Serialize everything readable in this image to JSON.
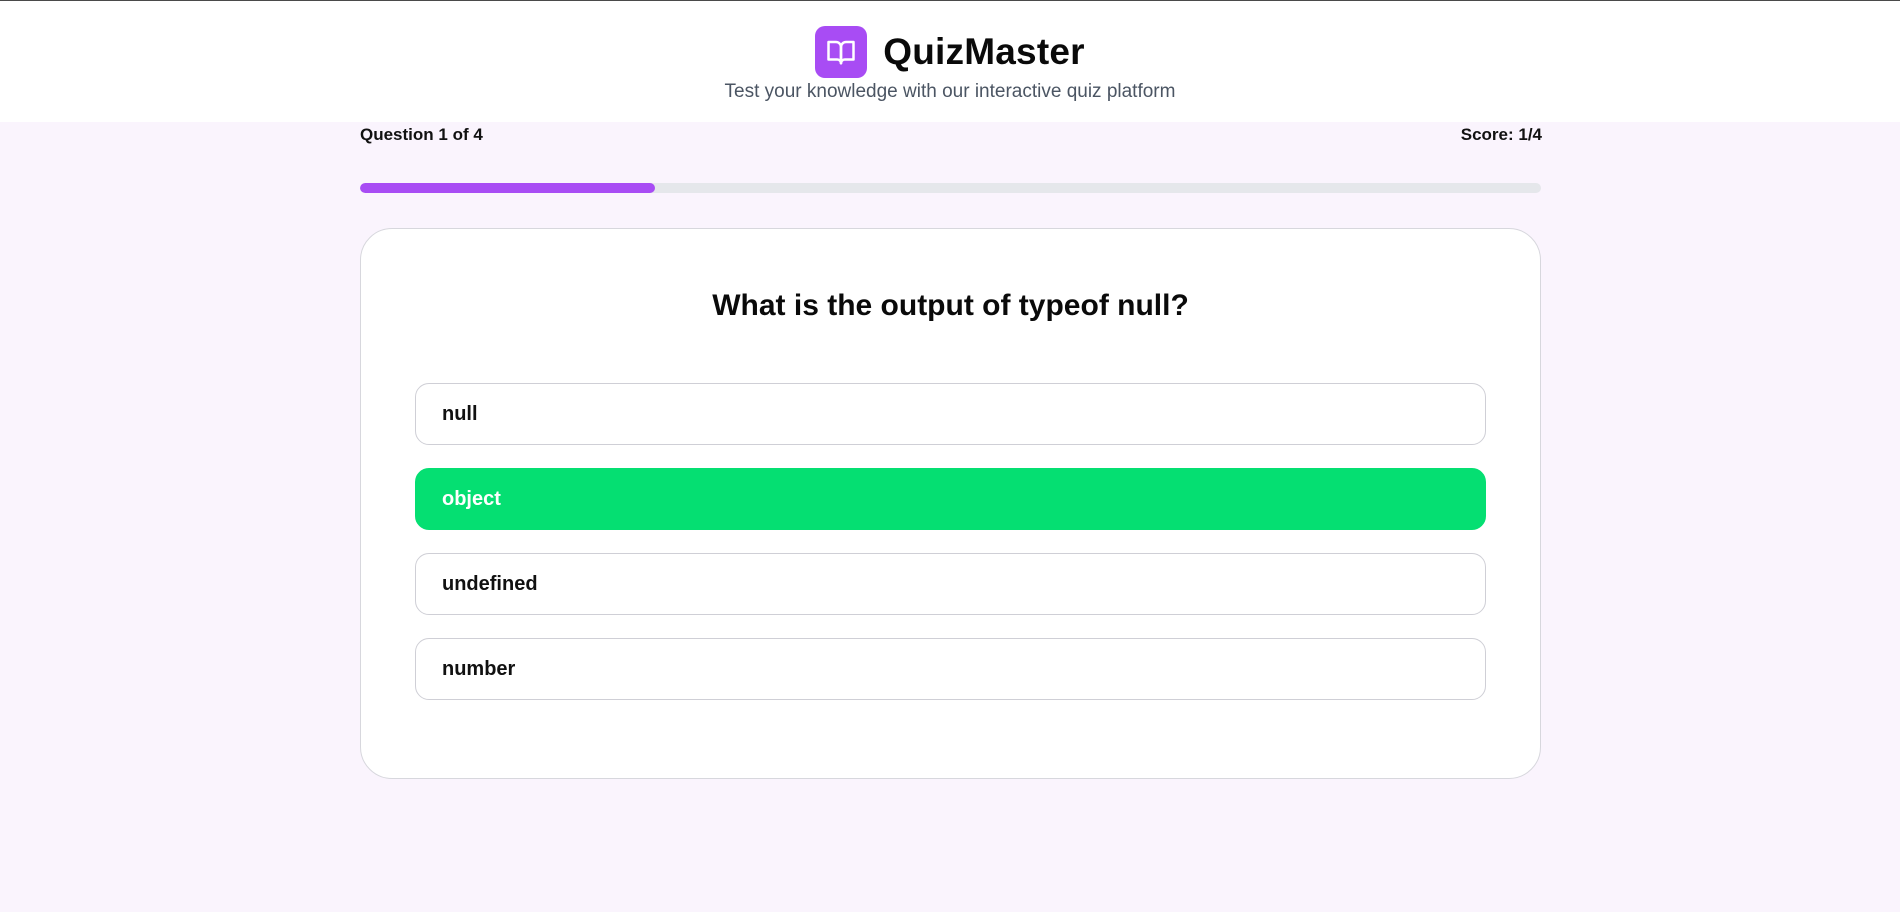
{
  "app": {
    "name": "QuizMaster",
    "tagline": "Test your knowledge with our interactive quiz platform",
    "logo_icon": "book-open-icon",
    "accent_color": "#a84cf4"
  },
  "progress": {
    "question_label": "Question 1 of 4",
    "score_label": "Score: 1/4",
    "fraction_complete": 0.25
  },
  "quiz": {
    "question": "What is the output of typeof null?",
    "options": [
      {
        "label": "null",
        "state": "default"
      },
      {
        "label": "object",
        "state": "correct"
      },
      {
        "label": "undefined",
        "state": "default"
      },
      {
        "label": "number",
        "state": "default"
      }
    ],
    "correct_color": "#05df72"
  }
}
